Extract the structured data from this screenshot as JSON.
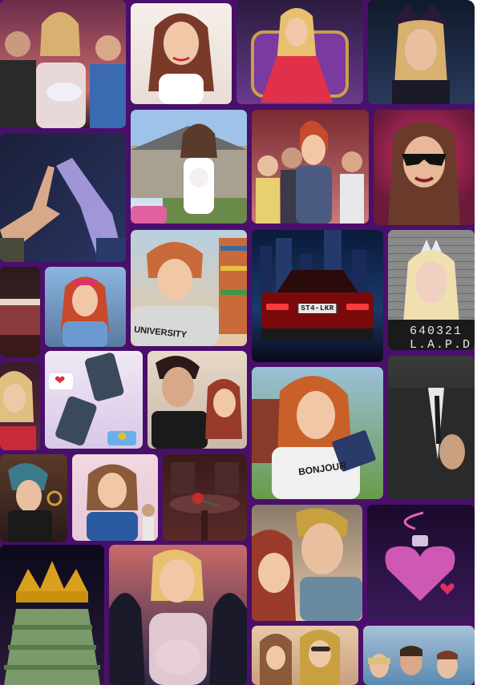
{
  "collage": {
    "background": "#4a0f6b",
    "tiles": [
      {
        "name": "tile-couple-with-baby",
        "colors": [
          "#6b2c4a",
          "#c96a6a",
          "#2b1c2a"
        ]
      },
      {
        "name": "tile-bride-portrait",
        "colors": [
          "#e9dcd6",
          "#f6efe9",
          "#7a3a2a"
        ]
      },
      {
        "name": "tile-blonde-on-throne",
        "colors": [
          "#2b1b3f",
          "#6a3a8c",
          "#c9a04a"
        ]
      },
      {
        "name": "tile-witch-with-crown",
        "colors": [
          "#0f1a2b",
          "#2a3a5c",
          "#6a4aa0"
        ]
      },
      {
        "name": "tile-reaching-hands",
        "colors": [
          "#1a1f3a",
          "#2a3560",
          "#b6a8f0"
        ]
      },
      {
        "name": "tile-woman-with-dog-mansion",
        "colors": [
          "#9fc3e8",
          "#e9eef4",
          "#6a7a6a"
        ]
      },
      {
        "name": "tile-redhead-with-friends",
        "colors": [
          "#7a2a30",
          "#4a5a80",
          "#c97a7a"
        ]
      },
      {
        "name": "tile-masked-woman",
        "colors": [
          "#6a1a3a",
          "#d9306a",
          "#2a0a1a"
        ]
      },
      {
        "name": "tile-bedroom",
        "colors": [
          "#4a2a2a",
          "#8a3a3a",
          "#2a1a1a"
        ]
      },
      {
        "name": "tile-girl-with-sunglasses",
        "colors": [
          "#8ab6e0",
          "#c94a2a",
          "#5a7aa0"
        ]
      },
      {
        "name": "tile-university-student",
        "colors": [
          "#e8c8a0",
          "#b8d0e0",
          "#c96a3a"
        ]
      },
      {
        "name": "tile-car-at-night",
        "colors": [
          "#0a1a3a",
          "#1a3a6a",
          "#7a0a0a"
        ]
      },
      {
        "name": "tile-mugshot",
        "colors": [
          "#5a5a5a",
          "#8a8a8a",
          "#2a2a2a"
        ]
      },
      {
        "name": "tile-blonde-red-dress",
        "colors": [
          "#3a1a2a",
          "#c92a3a",
          "#e0c080"
        ]
      },
      {
        "name": "tile-phones-texting",
        "colors": [
          "#d8c8e8",
          "#f0e8f4",
          "#3a4a5a"
        ]
      },
      {
        "name": "tile-couple-with-redhead",
        "colors": [
          "#e8d8c8",
          "#2a2a2a",
          "#9a3a2a"
        ]
      },
      {
        "name": "tile-girl-with-book-bonjour",
        "colors": [
          "#9ac0d8",
          "#6a9a4a",
          "#c9602a"
        ]
      },
      {
        "name": "tile-man-in-suit",
        "colors": [
          "#2a2a2a",
          "#5a5a5a",
          "#c9a080"
        ]
      },
      {
        "name": "tile-detective",
        "colors": [
          "#2a1a1a",
          "#5a3a2a",
          "#3a7a8a"
        ]
      },
      {
        "name": "tile-woman-blue-dress",
        "colors": [
          "#e8c8d8",
          "#2a5aa0",
          "#8a5a3a"
        ]
      },
      {
        "name": "tile-rose-on-table",
        "colors": [
          "#2a1a1a",
          "#5a2a2a",
          "#c92a2a"
        ]
      },
      {
        "name": "tile-couple-kissing",
        "colors": [
          "#e8c8a8",
          "#8a7a6a",
          "#c9a040"
        ]
      },
      {
        "name": "tile-love-potion",
        "colors": [
          "#1a0a2a",
          "#3a1a5a",
          "#e060c0"
        ]
      },
      {
        "name": "tile-crown-on-money",
        "colors": [
          "#0a0a1a",
          "#2a1a3a",
          "#d9a020"
        ]
      },
      {
        "name": "tile-pregnant-woman",
        "colors": [
          "#2a2a4a",
          "#c96a6a",
          "#1a1a2a"
        ]
      },
      {
        "name": "tile-friends-group",
        "colors": [
          "#e8c8a8",
          "#c9a080",
          "#8a5a3a"
        ]
      },
      {
        "name": "tile-men-group",
        "colors": [
          "#5a8ab0",
          "#a8c0d8",
          "#c9a080"
        ]
      }
    ],
    "texts": {
      "car_plate": "ST4-LKR",
      "mugshot_number": "640321",
      "mugshot_dept": "L.A.P.D",
      "shirt_university": "UNIVERSITY",
      "shirt_bonjour": "BONJOUR"
    }
  }
}
